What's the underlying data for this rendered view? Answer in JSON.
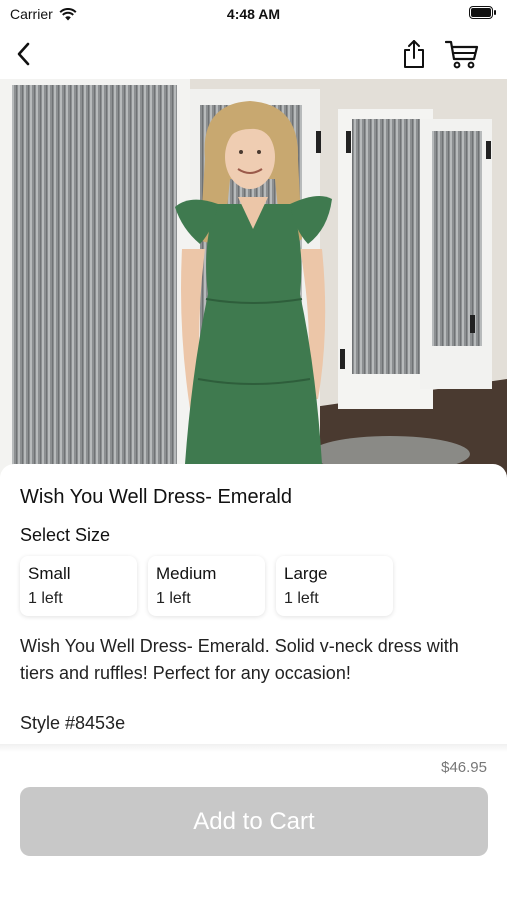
{
  "status_bar": {
    "carrier": "Carrier",
    "time": "4:48 AM"
  },
  "nav": {
    "back_icon": "chevron-left-icon",
    "share_icon": "share-icon",
    "cart_icon": "cart-icon"
  },
  "product": {
    "title": "Wish You Well Dress- Emerald",
    "select_size_label": "Select Size",
    "sizes": [
      {
        "name": "Small",
        "stock": "1 left"
      },
      {
        "name": "Medium",
        "stock": "1 left"
      },
      {
        "name": "Large",
        "stock": "1 left"
      }
    ],
    "description": "Wish You Well Dress- Emerald. Solid v-neck dress with tiers and ruffles! Perfect for any occasion!",
    "style": "Style #8453e",
    "price": "$46.95"
  },
  "actions": {
    "add_to_cart_label": "Add to Cart"
  },
  "colors": {
    "dress": "#3f7a4f",
    "button_disabled": "#c8c8c8",
    "price_text": "#777777"
  }
}
